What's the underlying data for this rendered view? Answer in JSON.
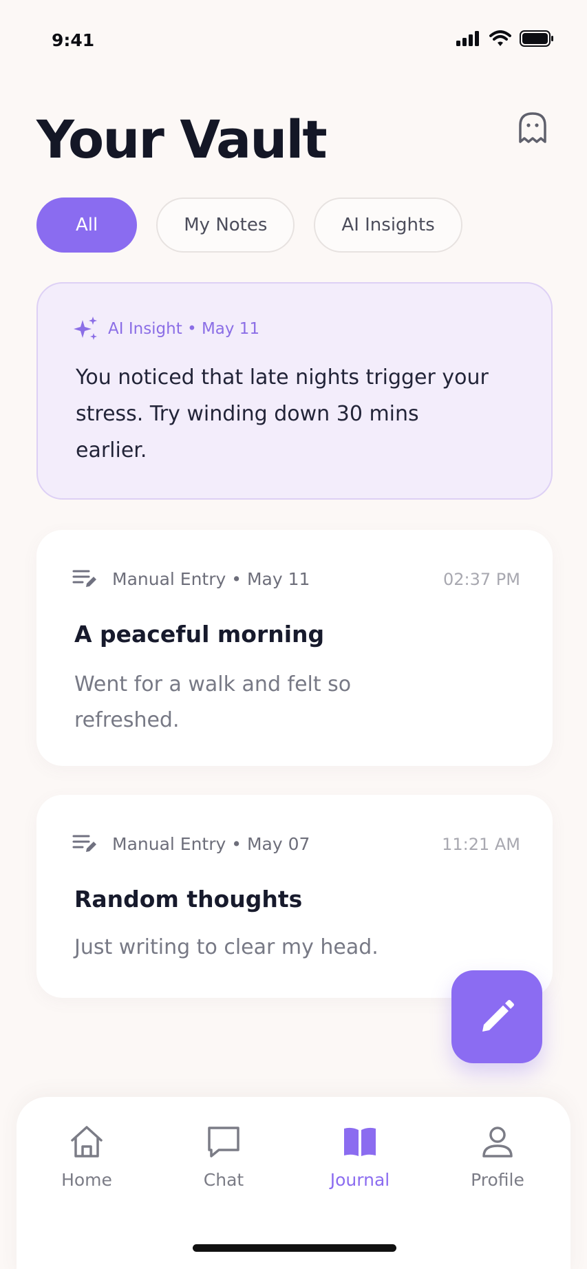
{
  "status_bar": {
    "time": "9:41"
  },
  "header": {
    "title": "Your Vault"
  },
  "filters": [
    {
      "label": "All",
      "active": true
    },
    {
      "label": "My Notes",
      "active": false
    },
    {
      "label": "AI Insights",
      "active": false
    }
  ],
  "insight_card": {
    "meta": "AI Insight • May 11",
    "body": "You noticed that late nights trigger your stress. Try winding down 30 mins earlier."
  },
  "entries": [
    {
      "meta": "Manual Entry • May 11",
      "time": "02:37 PM",
      "title": "A peaceful morning",
      "body": "Went for a walk and felt so refreshed."
    },
    {
      "meta": "Manual Entry • May 07",
      "time": "11:21 AM",
      "title": "Random thoughts",
      "body": "Just writing to clear my head."
    }
  ],
  "bottom_nav": [
    {
      "label": "Home",
      "icon": "home-icon",
      "active": false
    },
    {
      "label": "Chat",
      "icon": "chat-icon",
      "active": false
    },
    {
      "label": "Journal",
      "icon": "book-icon",
      "active": true
    },
    {
      "label": "Profile",
      "icon": "person-icon",
      "active": false
    }
  ],
  "colors": {
    "accent": "#8b6cf0",
    "background": "#fcf8f6",
    "insight_bg": "#f3edfb",
    "text_primary": "#16182b",
    "text_secondary": "#777985"
  }
}
